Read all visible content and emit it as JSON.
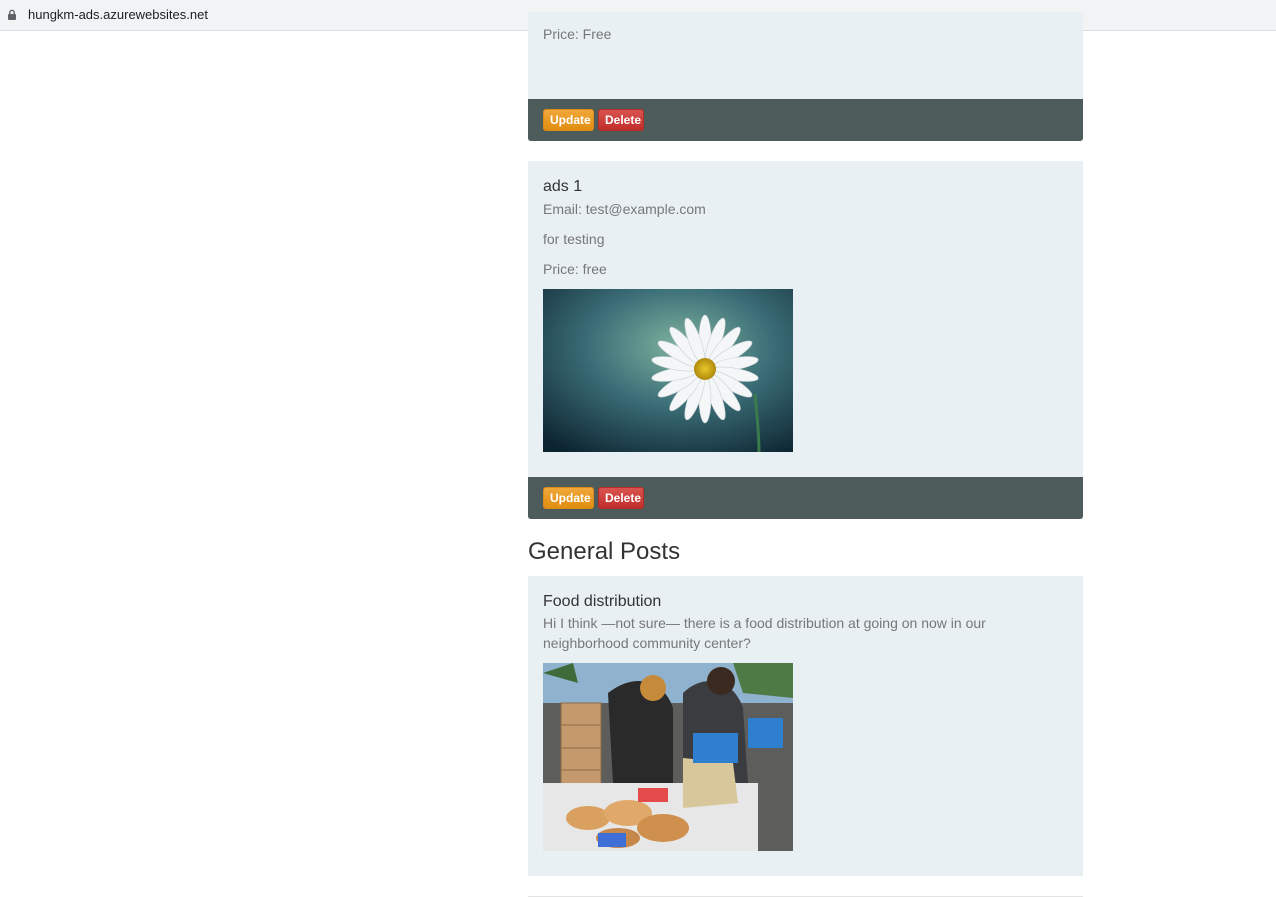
{
  "browser": {
    "url": "hungkm-ads.azurewebsites.net"
  },
  "ads": [
    {
      "price": "Price: Free",
      "update_label": "Update",
      "delete_label": "Delete"
    },
    {
      "title": "ads 1",
      "email": "Email: test@example.com",
      "description": "for testing",
      "price": "Price: free",
      "image": "daisy-flower-photo",
      "update_label": "Update",
      "delete_label": "Delete"
    }
  ],
  "general_posts": {
    "heading": "General Posts",
    "posts": [
      {
        "title": "Food distribution",
        "body_line1": "Hi I think —not sure— there is a food distribution at going on now in our",
        "body_line2": "neighborhood community center?",
        "image": "food-distribution-photo"
      }
    ]
  },
  "colors": {
    "card_bg": "#e9f0f4",
    "footer_bg": "#4d5b5b",
    "update": "#ec9a1e",
    "delete": "#d0403b"
  }
}
